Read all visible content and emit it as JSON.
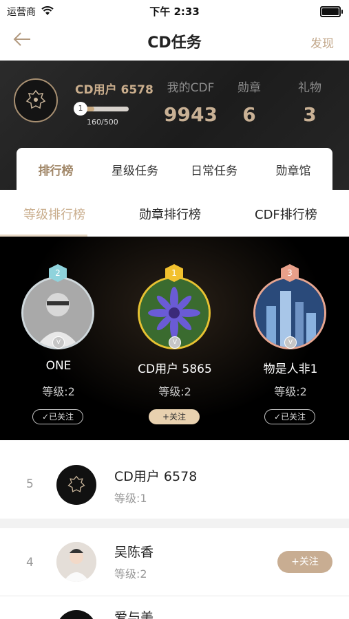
{
  "status_bar": {
    "carrier": "运营商",
    "time": "下午 2:33"
  },
  "nav": {
    "back_icon": "arrow-left-icon",
    "title": "CD任务",
    "right_link": "发现"
  },
  "profile": {
    "name": "CD用户 6578",
    "progress_level": "1",
    "progress_text": "160/500",
    "progress_fraction": 0.32,
    "stats": [
      {
        "label": "我的CDF",
        "value": "9943"
      },
      {
        "label": "勋章",
        "value": "6"
      },
      {
        "label": "礼物",
        "value": "3"
      }
    ]
  },
  "main_tabs": [
    "排行榜",
    "星级任务",
    "日常任务",
    "勋章馆"
  ],
  "sub_tabs": [
    "等级排行榜",
    "勋章排行榜",
    "CDF排行榜"
  ],
  "podium": [
    {
      "rank": "2",
      "name": "ONE",
      "level": "等级:2",
      "button": "✓已关注",
      "followed": true,
      "badge_color": "#8fd3dc",
      "ring_color": "#cfd8dc"
    },
    {
      "rank": "1",
      "name": "CD用户 5865",
      "level": "等级:2",
      "button": "+关注",
      "followed": false,
      "badge_color": "#f2c12e",
      "ring_color": "#e7c232"
    },
    {
      "rank": "3",
      "name": "物是人非1",
      "level": "等级:2",
      "button": "✓已关注",
      "followed": true,
      "badge_color": "#e8a08a",
      "ring_color": "#e7a691"
    }
  ],
  "list": [
    {
      "rank": "5",
      "name": "CD用户 6578",
      "level": "等级:1",
      "button": ""
    },
    {
      "rank": "4",
      "name": "吴陈香",
      "level": "等级:2",
      "button": "+关注"
    },
    {
      "rank": "",
      "name": "爱与美",
      "level": "",
      "button": ""
    }
  ],
  "colors": {
    "accent": "#c9ad8c",
    "dark_bg": "#1c1c1c"
  }
}
